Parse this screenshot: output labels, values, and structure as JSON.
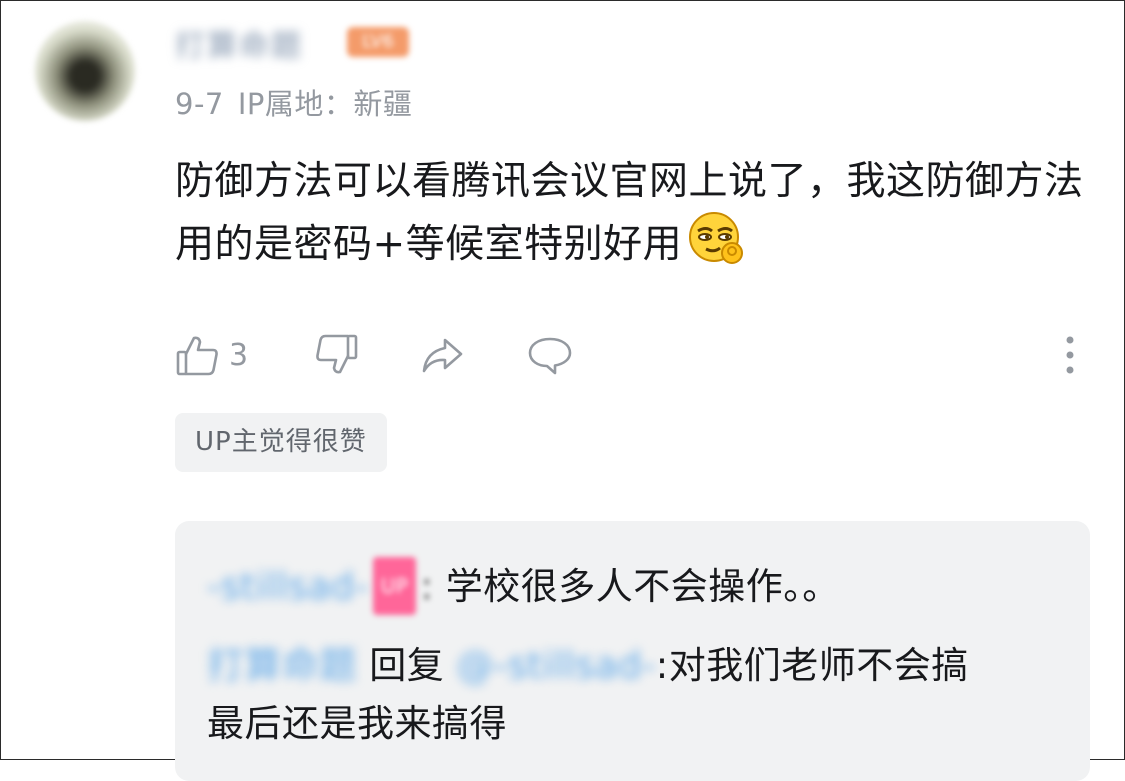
{
  "comment": {
    "username": "打算命题",
    "level_badge": "LV6",
    "date": "9-7",
    "ip_location": "IP属地：新疆",
    "text": "防御方法可以看腾讯会议官网上说了，我这防御方法用的是密码+等候室特别好用",
    "emoji_icon": "ok-smug-emoji-icon",
    "like_count": "3",
    "up_liked_badge": "UP主觉得很赞"
  },
  "actions": {
    "like_icon": "thumbs-up-icon",
    "dislike_icon": "thumbs-down-icon",
    "share_icon": "share-arrow-icon",
    "reply_icon": "speech-bubble-icon",
    "more_icon": "more-vertical-icon"
  },
  "replies": [
    {
      "author": "-stillsad-",
      "author_badge": "UP",
      "separator": ":",
      "text": "学校很多人不会操作。。"
    },
    {
      "author": "打算命题",
      "reply_word": "回复",
      "target": "@-stillsad-",
      "text_line1": ":对我们老师不会搞",
      "text_line2": "最后还是我来搞得"
    }
  ],
  "colors": {
    "text_primary": "#18191c",
    "text_secondary": "#9499a0",
    "link_blue": "#5fa8e8",
    "up_pink": "#ff6699",
    "panel_bg": "#f1f2f3"
  }
}
